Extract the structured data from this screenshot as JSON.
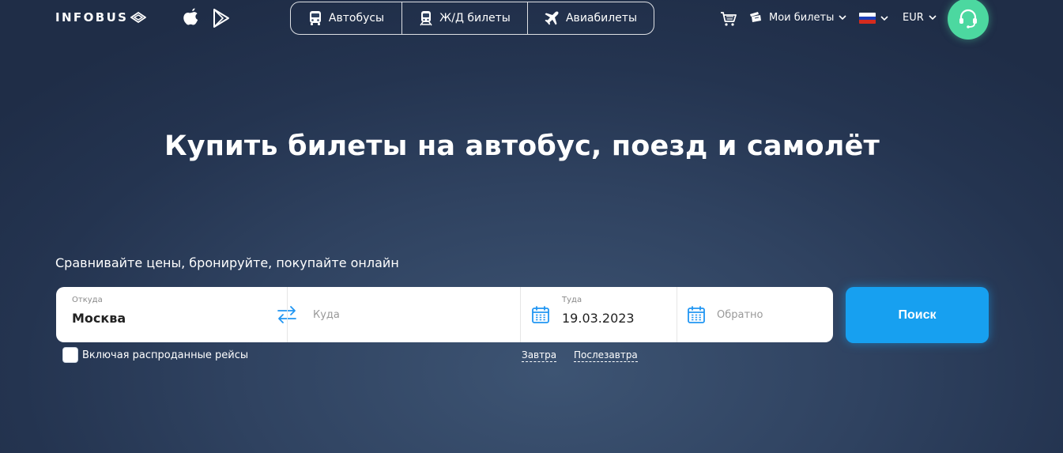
{
  "header": {
    "logo_text": "INFOBUS",
    "store_icons": [
      "apple-icon",
      "google-play-icon"
    ],
    "transport_tabs": [
      {
        "label": "Автобусы",
        "icon": "bus-icon"
      },
      {
        "label": "Ж/Д билеты",
        "icon": "train-icon"
      },
      {
        "label": "Авиабилеты",
        "icon": "plane-icon"
      }
    ],
    "cart_icon": "cart-icon",
    "my_tickets_label": "Мои билеты",
    "language_flag": "RU",
    "currency": "EUR",
    "support_icon": "headset-icon"
  },
  "hero": {
    "title": "Купить билеты на автобус, поезд и самолёт",
    "subtitle": "Сравнивайте цены, бронируйте, покупайте онлайн"
  },
  "search": {
    "from_label": "Откуда",
    "from_value": "Москва",
    "to_placeholder": "Куда",
    "depart_label": "Туда",
    "depart_value": "19.03.2023",
    "return_placeholder": "Обратно",
    "button_label": "Поиск",
    "include_sold_out_label": "Включая распроданные рейсы",
    "include_sold_out_checked": false,
    "quick_dates": [
      "Завтра",
      "Послезавтра"
    ]
  },
  "colors": {
    "accent": "#17a0f0",
    "support": "#4cd8a0",
    "icon_blue": "#2196f3"
  }
}
